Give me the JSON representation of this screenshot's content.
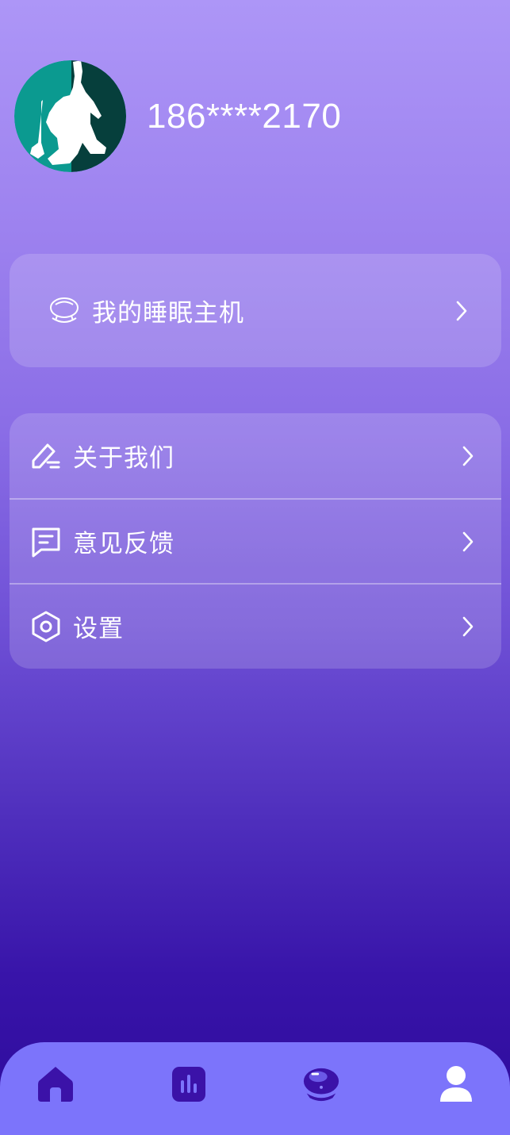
{
  "profile": {
    "username": "186****2170"
  },
  "host_card": {
    "label": "我的睡眠主机",
    "icon": "sleep-device-icon"
  },
  "menu": {
    "items": [
      {
        "label": "关于我们",
        "icon": "edit-icon"
      },
      {
        "label": "意见反馈",
        "icon": "feedback-icon"
      },
      {
        "label": "设置",
        "icon": "settings-icon"
      }
    ]
  },
  "tabbar": {
    "tabs": [
      {
        "icon": "home-icon"
      },
      {
        "icon": "stats-icon"
      },
      {
        "icon": "device-icon"
      },
      {
        "icon": "user-icon"
      }
    ]
  },
  "colors": {
    "tabbar_bg": "#7c74fb",
    "tab_icon": "#3b12a8",
    "active_tab_icon": "#ffffff"
  }
}
